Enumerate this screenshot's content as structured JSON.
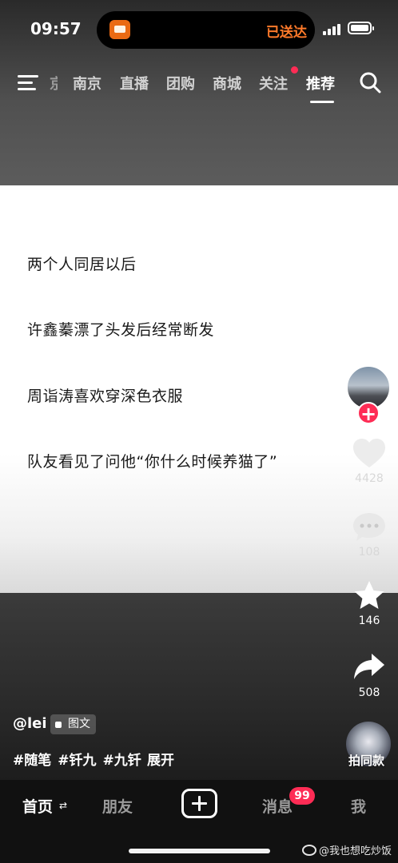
{
  "status_bar": {
    "time": "09:57",
    "island_status": "已送达",
    "island_status_color": "#ff7a2a"
  },
  "top_nav": {
    "tabs": [
      {
        "label": "京",
        "state": "cut-off"
      },
      {
        "label": "南京"
      },
      {
        "label": "直播"
      },
      {
        "label": "团购"
      },
      {
        "label": "商城"
      },
      {
        "label": "关注",
        "has_dot": true
      },
      {
        "label": "推荐",
        "active": true
      }
    ],
    "menu_icon": "menu-icon",
    "search_icon": "search-icon"
  },
  "card": {
    "lines": [
      "两个人同居以后",
      "许鑫蓁漂了头发后经常断发",
      "周诣涛喜欢穿深色衣服",
      "队友看见了问他“你什么时候养猫了”"
    ]
  },
  "actions": {
    "like_count": "4428",
    "comment_count": "108",
    "favorite_count": "146",
    "share_count": "508",
    "music_label": "拍同款"
  },
  "caption": {
    "author": "@lei",
    "badge": "图文",
    "hashtags": [
      "#随笔",
      "#钎九",
      "#九钎"
    ],
    "expand": "展开"
  },
  "bottom_bar": {
    "tabs": [
      {
        "label": "首页",
        "active": true
      },
      {
        "label": "朋友"
      },
      {
        "label": "消息",
        "badge": "99"
      },
      {
        "label": "我"
      }
    ],
    "swap_glyph": "⇄"
  },
  "watermark": "@我也想吃炒饭",
  "colors": {
    "accent_red": "#fe2c55",
    "tab_inactive": "#9a9a9a"
  }
}
